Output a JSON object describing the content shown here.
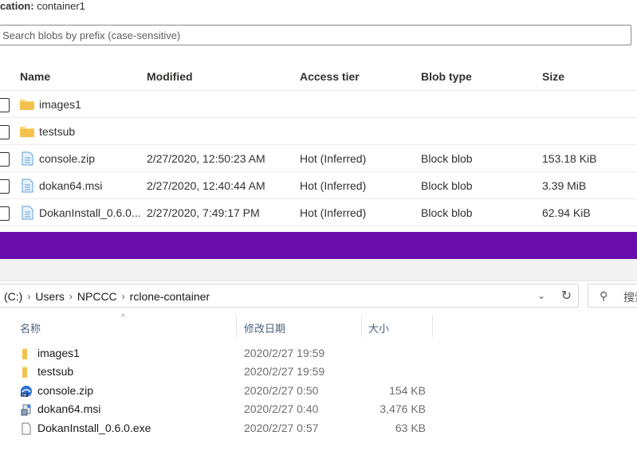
{
  "azure": {
    "location_label": "ocation:",
    "location_value": "container1",
    "search_placeholder": "Search blobs by prefix (case-sensitive)",
    "columns": [
      "Name",
      "Modified",
      "Access tier",
      "Blob type",
      "Size"
    ],
    "rows": [
      {
        "type": "folder",
        "name": "images1",
        "modified": "",
        "tier": "",
        "blob_type": "",
        "size": ""
      },
      {
        "type": "folder",
        "name": "testsub",
        "modified": "",
        "tier": "",
        "blob_type": "",
        "size": ""
      },
      {
        "type": "file",
        "name": "console.zip",
        "modified": "2/27/2020, 12:50:23 AM",
        "tier": "Hot (Inferred)",
        "blob_type": "Block blob",
        "size": "153.18 KiB"
      },
      {
        "type": "file",
        "name": "dokan64.msi",
        "modified": "2/27/2020, 12:40:44 AM",
        "tier": "Hot (Inferred)",
        "blob_type": "Block blob",
        "size": "3.39 MiB"
      },
      {
        "type": "file",
        "name": "DokanInstall_0.6.0...",
        "modified": "2/27/2020, 7:49:17 PM",
        "tier": "Hot (Inferred)",
        "blob_type": "Block blob",
        "size": "62.94 KiB"
      }
    ],
    "accent_color": "#6a0dad"
  },
  "explorer": {
    "breadcrumb": [
      "(C:)",
      "Users",
      "NPCCC",
      "rclone-container"
    ],
    "search_placeholder": "搜索",
    "columns": {
      "name": "名称",
      "date": "修改日期",
      "size": "大小"
    },
    "rows": [
      {
        "icon": "folder-icon",
        "name": "images1",
        "date": "2020/2/27 19:59",
        "size": ""
      },
      {
        "icon": "folder-icon",
        "name": "testsub",
        "date": "2020/2/27 19:59",
        "size": ""
      },
      {
        "icon": "zip-archive-icon",
        "name": "console.zip",
        "date": "2020/2/27 0:50",
        "size": "154 KB"
      },
      {
        "icon": "msi-installer-icon",
        "name": "dokan64.msi",
        "date": "2020/2/27 0:40",
        "size": "3,476 KB"
      },
      {
        "icon": "exe-file-icon",
        "name": "DokanInstall_0.6.0.exe",
        "date": "2020/2/27 0:57",
        "size": "63 KB"
      }
    ]
  }
}
